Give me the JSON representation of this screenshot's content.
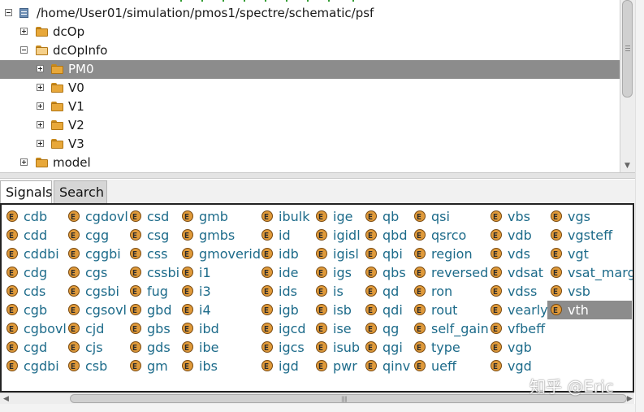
{
  "tree": {
    "root_path": "/home/User01/simulation/pmos1/spectre/schematic/psf",
    "items": [
      {
        "label": "dcOp"
      },
      {
        "label": "dcOpInfo"
      },
      {
        "label": "PM0"
      },
      {
        "label": "V0"
      },
      {
        "label": "V1"
      },
      {
        "label": "V2"
      },
      {
        "label": "V3"
      },
      {
        "label": "model"
      }
    ]
  },
  "tabs": [
    {
      "label": "Signals"
    },
    {
      "label": "Search"
    }
  ],
  "signals": {
    "columns": [
      [
        "cdb",
        "cdd",
        "cddbi",
        "cdg",
        "cds",
        "cgb",
        "cgbovl",
        "cgd",
        "cgdbi"
      ],
      [
        "cgdovl",
        "cgg",
        "cggbi",
        "cgs",
        "cgsbi",
        "cgsovl",
        "cjd",
        "cjs",
        "csb"
      ],
      [
        "csd",
        "csg",
        "css",
        "cssbi",
        "fug",
        "gbd",
        "gbs",
        "gds",
        "gm"
      ],
      [
        "gmb",
        "gmbs",
        "gmoverid",
        "i1",
        "i3",
        "i4",
        "ibd",
        "ibe",
        "ibs"
      ],
      [
        "ibulk",
        "id",
        "idb",
        "ide",
        "ids",
        "igb",
        "igcd",
        "igcs",
        "igd"
      ],
      [
        "ige",
        "igidl",
        "igisl",
        "igs",
        "is",
        "isb",
        "ise",
        "isub",
        "pwr"
      ],
      [
        "qb",
        "qbd",
        "qbi",
        "qbs",
        "qd",
        "qdi",
        "qg",
        "qgi",
        "qinv"
      ],
      [
        "qsi",
        "qsrco",
        "region",
        "reversed",
        "ron",
        "rout",
        "self_gain",
        "type",
        "ueff"
      ],
      [
        "vbs",
        "vdb",
        "vds",
        "vdsat",
        "vdss",
        "vearly",
        "vfbeff",
        "vgb",
        "vgd"
      ],
      [
        "vgs",
        "vgsteff",
        "vgt",
        "vsat_marg",
        "vsb",
        "vth"
      ]
    ],
    "selected": "vth"
  },
  "watermark": "知乎 @Eric",
  "colors": {
    "selection": "#8c8c8c",
    "signal_text": "#1d6b8a",
    "folder": "#e8a83a"
  },
  "icons": {
    "tree_root": "database-icon",
    "tree_item": "folder-icon",
    "signal": "expression-icon"
  }
}
